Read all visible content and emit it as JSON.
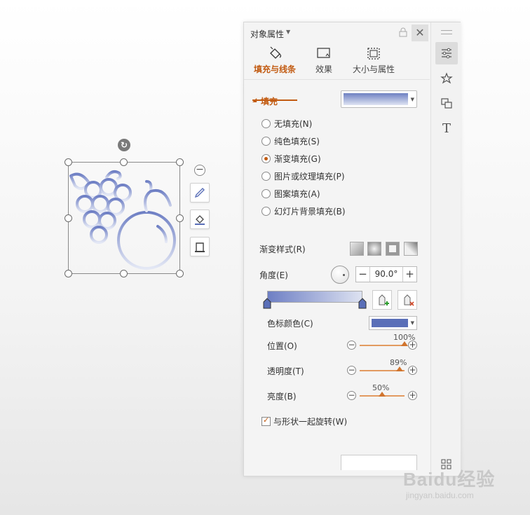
{
  "panel": {
    "title": "对象属性",
    "tabs": [
      {
        "label": "填充与线条",
        "active": true
      },
      {
        "label": "效果",
        "active": false
      },
      {
        "label": "大小与属性",
        "active": false
      }
    ],
    "fill": {
      "section_title": "填充",
      "options": [
        {
          "label": "无填充(N)",
          "checked": false
        },
        {
          "label": "纯色填充(S)",
          "checked": false
        },
        {
          "label": "渐变填充(G)",
          "checked": true
        },
        {
          "label": "图片或纹理填充(P)",
          "checked": false
        },
        {
          "label": "图案填充(A)",
          "checked": false
        },
        {
          "label": "幻灯片背景填充(B)",
          "checked": false
        }
      ],
      "gradient_style_label": "渐变样式(R)",
      "angle_label": "角度(E)",
      "angle_value": "90.0°",
      "angle_minus": "−",
      "angle_plus": "+",
      "stop_color_label": "色标颜色(C)",
      "position": {
        "label": "位置(O)",
        "value": "100%",
        "fraction": 1.0
      },
      "transparency": {
        "label": "透明度(T)",
        "value": "89%",
        "fraction": 0.89
      },
      "brightness": {
        "label": "亮度(B)",
        "value": "50%",
        "fraction": 0.5
      },
      "rotate_with_shape_label": "与形状一起旋转(W)",
      "rotate_with_shape_checked": true
    }
  },
  "colors": {
    "accent": "#c25b12",
    "gradient_start": "#6e7fc4",
    "gradient_end": "#dde2f1",
    "stop_color": "#5a6fb8"
  },
  "side_icons": [
    "settings-sliders-icon",
    "shape-star-icon",
    "replace-icon",
    "text-icon",
    "more-icon"
  ],
  "watermark": {
    "text": "Baidu经验",
    "sub": "jingyan.baidu.com"
  }
}
